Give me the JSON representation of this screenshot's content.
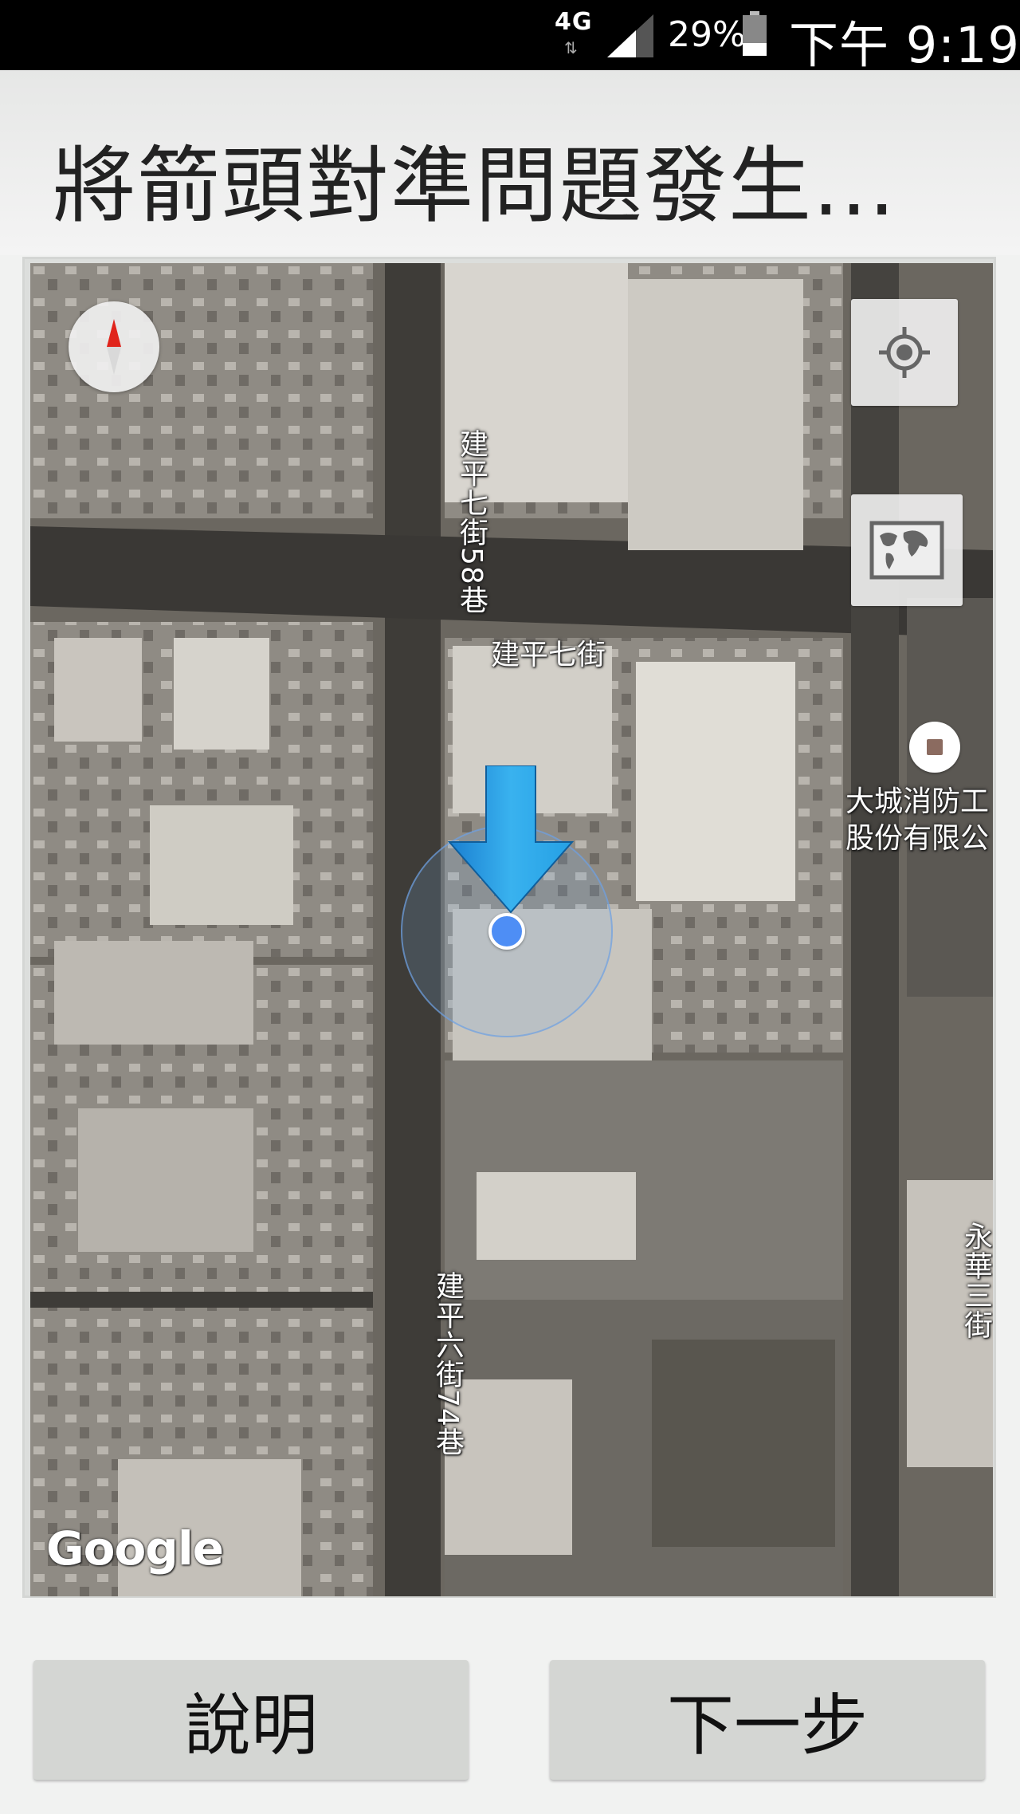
{
  "status_bar": {
    "network": "4G",
    "network_arrows": "⇅",
    "battery": "29%",
    "time": "下午 9:19"
  },
  "title": "將箭頭對準問題發生...",
  "map": {
    "road_labels": [
      "建平七街58巷",
      "建平七街",
      "建平六街74巷",
      "永華三街"
    ],
    "poi": {
      "line1": "大城消防工",
      "line2": "股份有限公"
    },
    "attribution": "Google",
    "controls": {
      "my_location_icon": "crosshair-location-icon",
      "layers_icon": "world-map-icon",
      "compass_icon": "compass-icon"
    },
    "colors": {
      "arrow": "#2fa6e6",
      "location_dot": "#4e8ef5"
    }
  },
  "buttons": {
    "help": "說明",
    "next": "下一步"
  }
}
